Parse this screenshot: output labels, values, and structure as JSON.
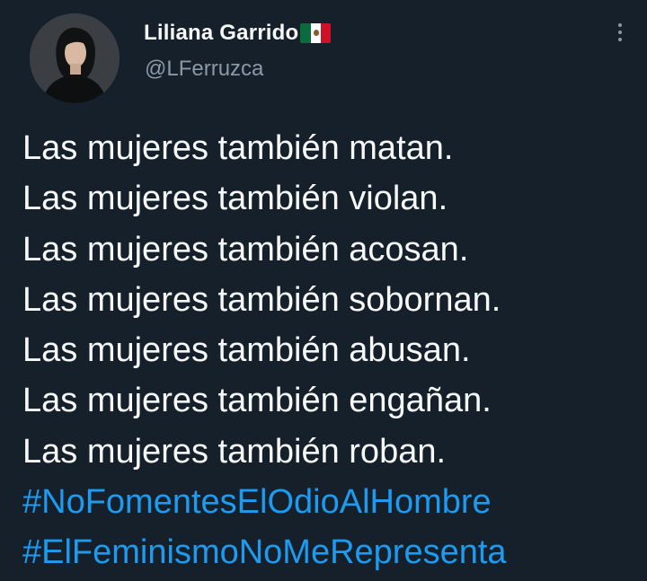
{
  "tweet": {
    "author": {
      "display_name": "Liliana Garrido",
      "handle": "@LFerruzca",
      "flag_icon": "mexico-flag-icon"
    },
    "more_icon": "more-options-icon",
    "lines": [
      "Las mujeres también matan.",
      "Las mujeres también violan.",
      "Las mujeres también acosan.",
      "Las mujeres también sobornan.",
      "Las mujeres también abusan.",
      "Las mujeres también engañan.",
      "Las mujeres también roban."
    ],
    "hashtags": [
      "#NoFomentesElOdioAlHombre",
      "#ElFeminismoNoMeRepresenta"
    ]
  },
  "colors": {
    "background": "#15202b",
    "text_primary": "#f7f9f9",
    "text_secondary": "#8b98a5",
    "link": "#1d9bf0"
  }
}
